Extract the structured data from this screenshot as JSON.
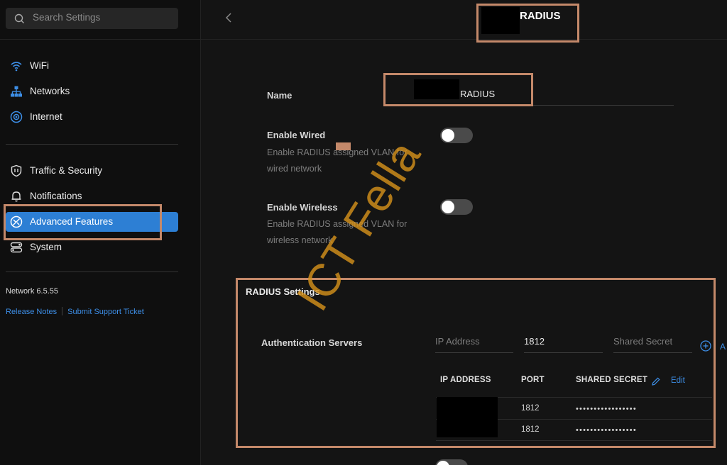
{
  "sidebar": {
    "search_placeholder": "Search Settings",
    "items_group1": [
      {
        "label": "WiFi",
        "icon": "wifi-icon"
      },
      {
        "label": "Networks",
        "icon": "networks-icon"
      },
      {
        "label": "Internet",
        "icon": "globe-icon"
      }
    ],
    "items_group2": [
      {
        "label": "Traffic & Security",
        "icon": "shield-icon"
      },
      {
        "label": "Notifications",
        "icon": "bell-icon"
      },
      {
        "label": "Advanced Features",
        "icon": "advanced-features-icon",
        "active": true
      },
      {
        "label": "System",
        "icon": "system-icon"
      }
    ],
    "version": "Network 6.5.55",
    "release_notes": "Release Notes",
    "support_ticket": "Submit Support Ticket"
  },
  "header": {
    "title": "RADIUS"
  },
  "form": {
    "name_label": "Name",
    "name_value": "RADIUS",
    "enable_wired_label": "Enable Wired",
    "enable_wired_desc1": "Enable RADIUS assigned VLAN for",
    "enable_wired_desc2": "wired network",
    "enable_wired": false,
    "enable_wireless_label": "Enable Wireless",
    "enable_wireless_desc1": "Enable RADIUS assigned VLAN for",
    "enable_wireless_desc2": "wireless network",
    "enable_wireless": false
  },
  "radius": {
    "section_title": "RADIUS Settings",
    "auth_servers_label": "Authentication Servers",
    "ip_placeholder": "IP Address",
    "port_value": "1812",
    "secret_placeholder": "Shared Secret",
    "add_label": "A",
    "columns": [
      "IP ADDRESS",
      "PORT",
      "SHARED SECRET"
    ],
    "edit_label": "Edit",
    "rows": [
      {
        "port": "1812",
        "secret": "•••••••••••••••••"
      },
      {
        "port": "1812",
        "secret": "•••••••••••••••••"
      }
    ]
  },
  "watermark": "ICT Fella",
  "colors": {
    "accent": "#2d7fd4",
    "link": "#3d8ee6",
    "highlight_box": "#c4896a",
    "watermark": "#d3901b"
  }
}
